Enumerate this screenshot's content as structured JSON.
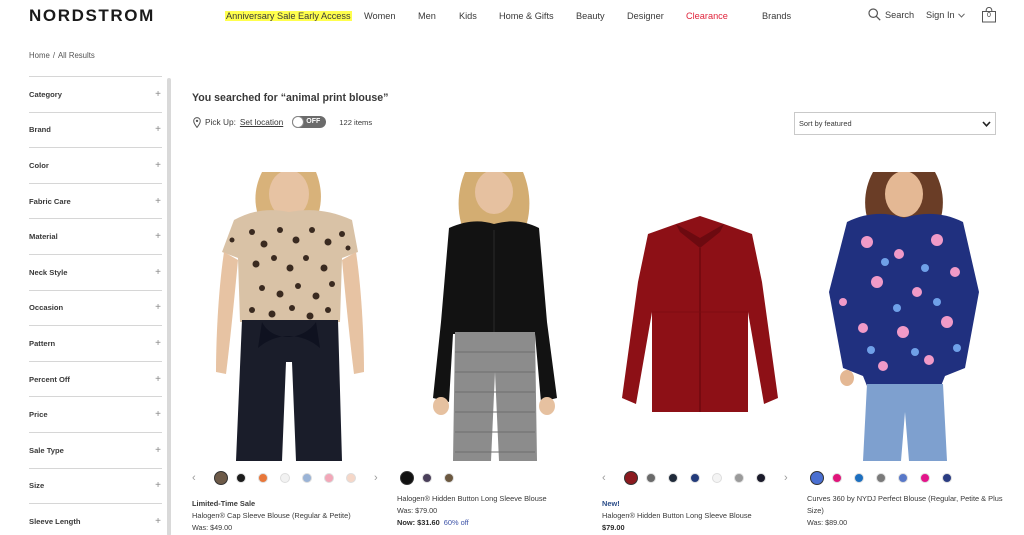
{
  "header": {
    "logo": "NORDSTROM",
    "nav": [
      {
        "label": "Anniversary Sale Early Access",
        "style": "highlight"
      },
      {
        "label": "Women"
      },
      {
        "label": "Men"
      },
      {
        "label": "Kids"
      },
      {
        "label": "Home & Gifts"
      },
      {
        "label": "Beauty"
      },
      {
        "label": "Designer"
      },
      {
        "label": "Clearance",
        "style": "clearance"
      },
      {
        "label": "Brands"
      }
    ],
    "search_label": "Search",
    "signin_label": "Sign In",
    "bag_count": "0"
  },
  "breadcrumb": {
    "home": "Home",
    "separator": "/",
    "current": "All Results"
  },
  "sidebar": {
    "facets": [
      "Category",
      "Brand",
      "Color",
      "Fabric Care",
      "Material",
      "Neck Style",
      "Occasion",
      "Pattern",
      "Percent Off",
      "Price",
      "Sale Type",
      "Size",
      "Sleeve Length"
    ],
    "plus_glyph": "+"
  },
  "main": {
    "search_title": "You searched for “animal print blouse”",
    "pickup_label": "Pick Up:",
    "set_location": "Set location",
    "toggle_label": "OFF",
    "items_count": "122 items",
    "sort_selected": "Sort by featured"
  },
  "products": [
    {
      "badge": "Limited-Time Sale",
      "name": "Halogen® Cap Sleeve Blouse (Regular & Petite)",
      "was": "Was: $49.00",
      "now": "",
      "pct": "",
      "swatches": [
        "#6d5a48",
        "#1c1c1c",
        "#e8773a",
        "#f2f2f2",
        "#9ab3d6",
        "#f2a7b8",
        "#f5d7c8"
      ],
      "has_arrows": true
    },
    {
      "badge": "",
      "name": "Halogen® Hidden Button Long Sleeve Blouse",
      "was": "Was: $79.00",
      "now": "Now: $31.60",
      "pct": "60% off",
      "swatches": [
        "#111111",
        "#4a3f5a",
        "#6b5840"
      ],
      "has_arrows": false
    },
    {
      "badge": "New!",
      "name": "Halogen® Hidden Button Long Sleeve Blouse",
      "was": "",
      "now": "$79.00",
      "pct": "",
      "swatches": [
        "#8b1a1f",
        "#6a6a6a",
        "#1f2a3a",
        "#233b7a",
        "#f4f4f4",
        "#9a9a9a",
        "#1a1a2a"
      ],
      "has_arrows": true
    },
    {
      "badge": "",
      "name": "Curves 360 by NYDJ Perfect Blouse (Regular, Petite & Plus Size)",
      "was": "Was: $89.00",
      "now": "",
      "pct": "",
      "swatches": [
        "#4a6fd1",
        "#e0147a",
        "#1d6fbf",
        "#7a7a7a",
        "#5878c8",
        "#e3148a",
        "#2a3c82"
      ],
      "has_arrows": false
    }
  ]
}
